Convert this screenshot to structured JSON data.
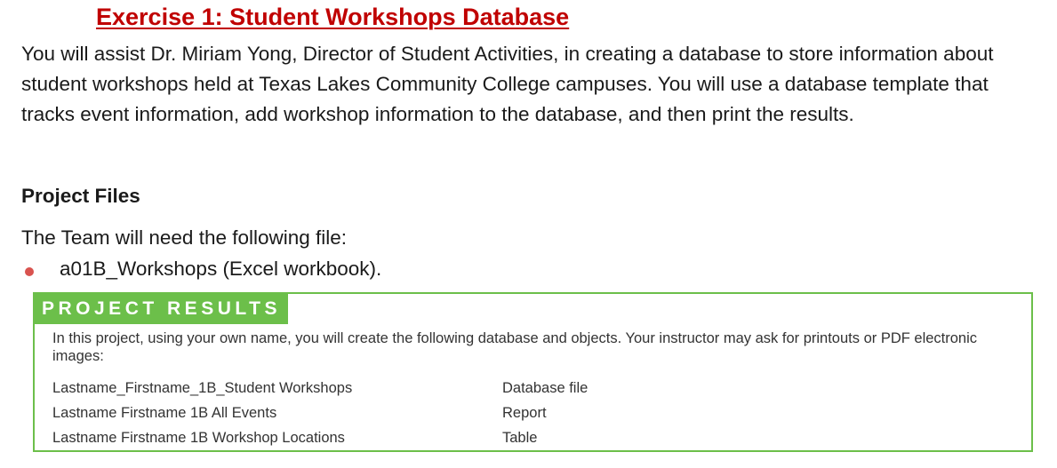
{
  "title": "Exercise 1: Student Workshops Database",
  "intro": "You will assist Dr. Miriam Yong, Director of Student Activities, in creating a database to store information about student workshops held at Texas Lakes Community College campuses. You will use a database template that tracks event information, add workshop information to the database, and then print the results.",
  "project_files": {
    "heading": "Project Files",
    "need_line": "The Team will need the following file:",
    "files": [
      "a01B_Workshops (Excel workbook)."
    ]
  },
  "project_results": {
    "header": "PROJECT RESULTS",
    "description": "In this project, using your own name, you will create the following database and objects. Your instructor may ask for printouts or PDF electronic images:",
    "rows": [
      {
        "name": "Lastname_Firstname_1B_Student Workshops",
        "type": "Database file"
      },
      {
        "name": "Lastname Firstname 1B All Events",
        "type": "Report"
      },
      {
        "name": "Lastname Firstname 1B Workshop Locations",
        "type": "Table"
      }
    ]
  },
  "colors": {
    "title": "#c00000",
    "results_green": "#6cbf4a",
    "bullet": "#d9534f"
  }
}
